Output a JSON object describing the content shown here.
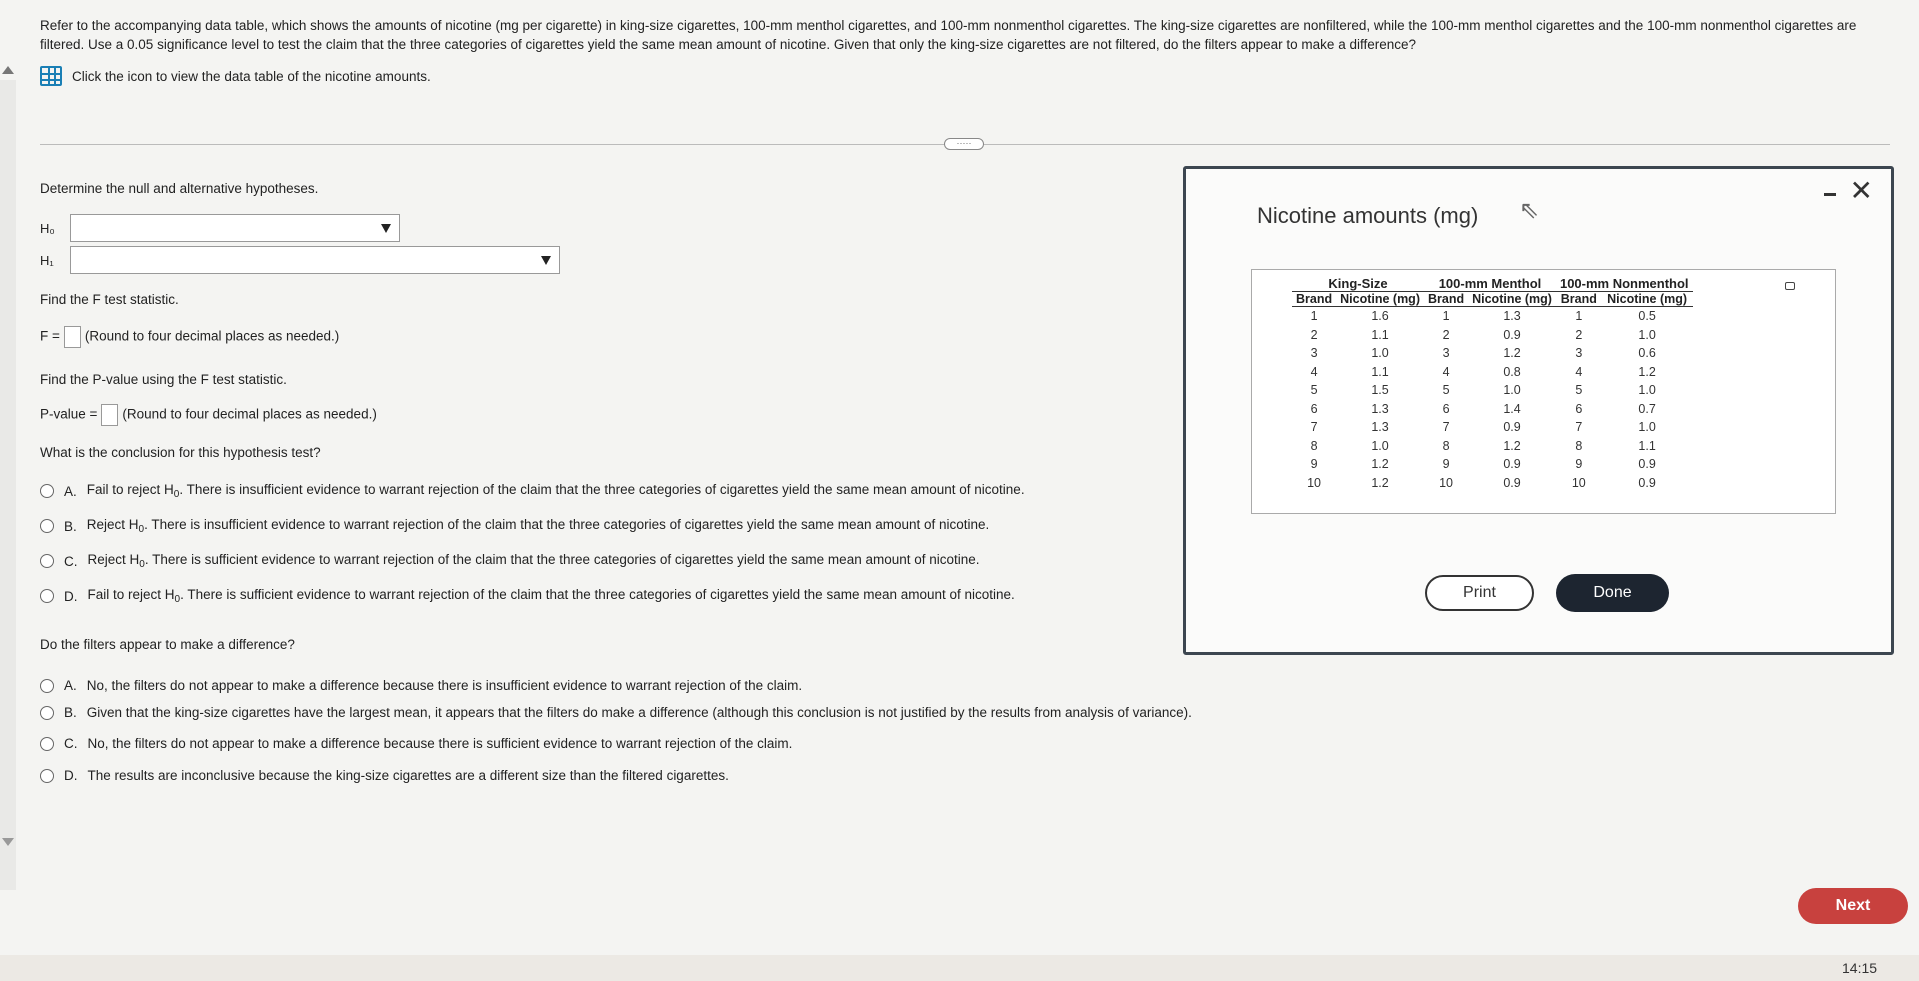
{
  "problem": {
    "text": "Refer to the accompanying data table, which shows the amounts of nicotine (mg per cigarette) in king-size cigarettes, 100-mm menthol cigarettes, and 100-mm nonmenthol cigarettes. The king-size cigarettes are nonfiltered, while the 100-mm menthol cigarettes and the 100-mm nonmenthol cigarettes are filtered. Use a 0.05 significance level to test the claim that the three categories of cigarettes yield the same mean amount of nicotine. Given that only the king-size cigarettes are not filtered, do the filters appear to make a difference?",
    "data_link": "Click the icon to view the data table of the nicotine amounts."
  },
  "handle": "·····",
  "hypotheses": {
    "prompt": "Determine the null and alternative hypotheses.",
    "h0_label": "H₀",
    "h1_label": "H₁"
  },
  "f_stat": {
    "prompt": "Find the F test statistic.",
    "label": "F =",
    "note": "(Round to four decimal places as needed.)"
  },
  "p_value": {
    "prompt": "Find the P-value using the F test statistic.",
    "label": "P-value =",
    "note": "(Round to four decimal places as needed.)"
  },
  "conclusion": {
    "prompt": "What is the conclusion for this hypothesis test?",
    "options": [
      {
        "letter": "A.",
        "pre": "Fail to reject H",
        "post": ". There is insufficient evidence to warrant rejection of the claim that the three categories of cigarettes yield the same mean amount of nicotine."
      },
      {
        "letter": "B.",
        "pre": "Reject H",
        "post": ". There is insufficient evidence to warrant rejection of the claim that the three categories of cigarettes yield the same mean amount of nicotine."
      },
      {
        "letter": "C.",
        "pre": "Reject H",
        "post": ". There is sufficient evidence to warrant rejection of the claim that the three categories of cigarettes yield the same mean amount of nicotine."
      },
      {
        "letter": "D.",
        "pre": "Fail to reject H",
        "post": ". There is sufficient evidence to warrant rejection of the claim that the three categories of cigarettes yield the same mean amount of nicotine."
      }
    ]
  },
  "filters": {
    "prompt": "Do the filters appear to make a difference?",
    "options": [
      {
        "letter": "A.",
        "text": "No, the filters do not appear to make a difference because there is insufficient evidence to warrant rejection of the claim."
      },
      {
        "letter": "B.",
        "text": "Given that the king-size cigarettes have the largest mean, it appears that the filters do make a difference (although this conclusion is not justified by the results from analysis of variance)."
      },
      {
        "letter": "C.",
        "text": "No, the filters do not appear to make a difference because there is sufficient evidence to warrant rejection of the claim."
      },
      {
        "letter": "D.",
        "text": "The results are inconclusive because the king-size cigarettes are a different size than the filtered cigarettes."
      }
    ]
  },
  "modal": {
    "title": "Nicotine amounts (mg)",
    "groups": [
      "King-Size",
      "100-mm Menthol",
      "100-mm Nonmenthol"
    ],
    "sub_headers": [
      "Brand",
      "Nicotine (mg)"
    ],
    "rows": [
      [
        "1",
        "1.6",
        "1",
        "1.3",
        "1",
        "0.5"
      ],
      [
        "2",
        "1.1",
        "2",
        "0.9",
        "2",
        "1.0"
      ],
      [
        "3",
        "1.0",
        "3",
        "1.2",
        "3",
        "0.6"
      ],
      [
        "4",
        "1.1",
        "4",
        "0.8",
        "4",
        "1.2"
      ],
      [
        "5",
        "1.5",
        "5",
        "1.0",
        "5",
        "1.0"
      ],
      [
        "6",
        "1.3",
        "6",
        "1.4",
        "6",
        "0.7"
      ],
      [
        "7",
        "1.3",
        "7",
        "0.9",
        "7",
        "1.0"
      ],
      [
        "8",
        "1.0",
        "8",
        "1.2",
        "8",
        "1.1"
      ],
      [
        "9",
        "1.2",
        "9",
        "0.9",
        "9",
        "0.9"
      ],
      [
        "10",
        "1.2",
        "10",
        "0.9",
        "10",
        "0.9"
      ]
    ],
    "print_label": "Print",
    "done_label": "Done",
    "close_glyph": "✕"
  },
  "next_label": "Next",
  "clock": "14:15"
}
